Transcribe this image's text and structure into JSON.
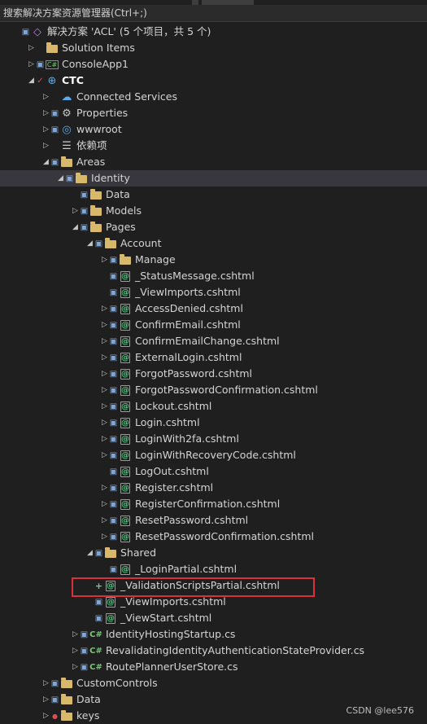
{
  "search": {
    "placeholder": "搜索解决方案资源管理器(Ctrl+;)"
  },
  "tree": [
    {
      "label": "解决方案 'ACL' (5 个项目，共 5 个)",
      "expander": "none",
      "mod": "lock",
      "icon": "solution-icon"
    },
    {
      "label": "Solution Items",
      "expander": "collapsed",
      "mod": "",
      "icon": "folder-icon"
    },
    {
      "label": "ConsoleApp1",
      "expander": "collapsed",
      "mod": "lock",
      "icon": "csharp-project-icon"
    },
    {
      "label": "CTC",
      "expander": "expanded",
      "mod": "check",
      "icon": "web-project-icon",
      "bold": true
    },
    {
      "label": "Connected Services",
      "expander": "collapsed",
      "mod": "",
      "icon": "connected-services-icon"
    },
    {
      "label": "Properties",
      "expander": "collapsed",
      "mod": "lock",
      "icon": "properties-icon"
    },
    {
      "label": "wwwroot",
      "expander": "collapsed",
      "mod": "lock",
      "icon": "globe-icon"
    },
    {
      "label": "依赖项",
      "expander": "collapsed",
      "mod": "",
      "icon": "dependencies-icon"
    },
    {
      "label": "Areas",
      "expander": "expanded",
      "mod": "lock",
      "icon": "folder-icon"
    },
    {
      "label": "Identity",
      "expander": "expanded",
      "mod": "lock",
      "icon": "folder-icon",
      "selected": true
    },
    {
      "label": "Data",
      "expander": "none",
      "mod": "lock",
      "icon": "folder-icon"
    },
    {
      "label": "Models",
      "expander": "collapsed",
      "mod": "lock",
      "icon": "folder-icon"
    },
    {
      "label": "Pages",
      "expander": "expanded",
      "mod": "lock",
      "icon": "folder-icon"
    },
    {
      "label": "Account",
      "expander": "expanded",
      "mod": "lock",
      "icon": "folder-icon"
    },
    {
      "label": "Manage",
      "expander": "collapsed",
      "mod": "lock",
      "icon": "folder-icon"
    },
    {
      "label": "_StatusMessage.cshtml",
      "expander": "none",
      "mod": "lock",
      "icon": "razor-file-icon"
    },
    {
      "label": "_ViewImports.cshtml",
      "expander": "none",
      "mod": "lock",
      "icon": "razor-file-icon"
    },
    {
      "label": "AccessDenied.cshtml",
      "expander": "collapsed",
      "mod": "lock",
      "icon": "razor-file-icon"
    },
    {
      "label": "ConfirmEmail.cshtml",
      "expander": "collapsed",
      "mod": "lock",
      "icon": "razor-file-icon"
    },
    {
      "label": "ConfirmEmailChange.cshtml",
      "expander": "collapsed",
      "mod": "lock",
      "icon": "razor-file-icon"
    },
    {
      "label": "ExternalLogin.cshtml",
      "expander": "collapsed",
      "mod": "lock",
      "icon": "razor-file-icon"
    },
    {
      "label": "ForgotPassword.cshtml",
      "expander": "collapsed",
      "mod": "lock",
      "icon": "razor-file-icon"
    },
    {
      "label": "ForgotPasswordConfirmation.cshtml",
      "expander": "collapsed",
      "mod": "lock",
      "icon": "razor-file-icon"
    },
    {
      "label": "Lockout.cshtml",
      "expander": "collapsed",
      "mod": "lock",
      "icon": "razor-file-icon"
    },
    {
      "label": "Login.cshtml",
      "expander": "collapsed",
      "mod": "lock",
      "icon": "razor-file-icon"
    },
    {
      "label": "LoginWith2fa.cshtml",
      "expander": "collapsed",
      "mod": "lock",
      "icon": "razor-file-icon"
    },
    {
      "label": "LoginWithRecoveryCode.cshtml",
      "expander": "collapsed",
      "mod": "lock",
      "icon": "razor-file-icon"
    },
    {
      "label": "LogOut.cshtml",
      "expander": "none",
      "mod": "lock",
      "icon": "razor-file-icon"
    },
    {
      "label": "Register.cshtml",
      "expander": "collapsed",
      "mod": "lock",
      "icon": "razor-file-icon"
    },
    {
      "label": "RegisterConfirmation.cshtml",
      "expander": "collapsed",
      "mod": "lock",
      "icon": "razor-file-icon"
    },
    {
      "label": "ResetPassword.cshtml",
      "expander": "collapsed",
      "mod": "lock",
      "icon": "razor-file-icon"
    },
    {
      "label": "ResetPasswordConfirmation.cshtml",
      "expander": "collapsed",
      "mod": "lock",
      "icon": "razor-file-icon"
    },
    {
      "label": "Shared",
      "expander": "expanded",
      "mod": "lock",
      "icon": "folder-icon"
    },
    {
      "label": "_LoginPartial.cshtml",
      "expander": "none",
      "mod": "lock",
      "icon": "razor-file-icon"
    },
    {
      "label": "_ValidationScriptsPartial.cshtml",
      "expander": "none",
      "mod": "plus",
      "icon": "razor-file-icon"
    },
    {
      "label": "_ViewImports.cshtml",
      "expander": "none",
      "mod": "lock",
      "icon": "razor-file-icon"
    },
    {
      "label": "_ViewStart.cshtml",
      "expander": "none",
      "mod": "lock",
      "icon": "razor-file-icon"
    },
    {
      "label": "IdentityHostingStartup.cs",
      "expander": "collapsed",
      "mod": "lock",
      "icon": "csharp-file-icon"
    },
    {
      "label": "RevalidatingIdentityAuthenticationStateProvider.cs",
      "expander": "collapsed",
      "mod": "lock",
      "icon": "csharp-file-icon"
    },
    {
      "label": "RoutePlannerUserStore.cs",
      "expander": "collapsed",
      "mod": "lock",
      "icon": "csharp-file-icon"
    },
    {
      "label": "CustomControls",
      "expander": "collapsed",
      "mod": "lock",
      "icon": "folder-icon"
    },
    {
      "label": "Data",
      "expander": "collapsed",
      "mod": "lock",
      "icon": "folder-icon"
    },
    {
      "label": "keys",
      "expander": "collapsed",
      "mod": "none",
      "icon": "folder-icon"
    }
  ],
  "watermark": "CSDN @lee576"
}
